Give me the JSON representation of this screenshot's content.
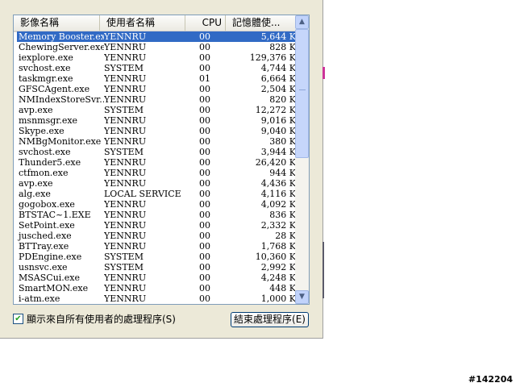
{
  "columns": [
    "影像名稱",
    "使用者名稱",
    "CPU",
    "記憶體使..."
  ],
  "processes": [
    {
      "name": "Memory Booster.exe",
      "user": "YENNRU",
      "cpu": "00",
      "mem": "5,644 K",
      "selected": true
    },
    {
      "name": "ChewingServer.exe",
      "user": "YENNRU",
      "cpu": "00",
      "mem": "828 K"
    },
    {
      "name": "iexplore.exe",
      "user": "YENNRU",
      "cpu": "00",
      "mem": "129,376 K"
    },
    {
      "name": "svchost.exe",
      "user": "SYSTEM",
      "cpu": "00",
      "mem": "4,744 K"
    },
    {
      "name": "taskmgr.exe",
      "user": "YENNRU",
      "cpu": "01",
      "mem": "6,664 K"
    },
    {
      "name": "GFSCAgent.exe",
      "user": "YENNRU",
      "cpu": "00",
      "mem": "2,504 K"
    },
    {
      "name": "NMIndexStoreSvr....",
      "user": "YENNRU",
      "cpu": "00",
      "mem": "820 K"
    },
    {
      "name": "avp.exe",
      "user": "SYSTEM",
      "cpu": "00",
      "mem": "12,272 K"
    },
    {
      "name": "msnmsgr.exe",
      "user": "YENNRU",
      "cpu": "00",
      "mem": "9,016 K"
    },
    {
      "name": "Skype.exe",
      "user": "YENNRU",
      "cpu": "00",
      "mem": "9,040 K"
    },
    {
      "name": "NMBgMonitor.exe",
      "user": "YENNRU",
      "cpu": "00",
      "mem": "380 K"
    },
    {
      "name": "svchost.exe",
      "user": "SYSTEM",
      "cpu": "00",
      "mem": "3,944 K"
    },
    {
      "name": "Thunder5.exe",
      "user": "YENNRU",
      "cpu": "00",
      "mem": "26,420 K"
    },
    {
      "name": "ctfmon.exe",
      "user": "YENNRU",
      "cpu": "00",
      "mem": "944 K"
    },
    {
      "name": "avp.exe",
      "user": "YENNRU",
      "cpu": "00",
      "mem": "4,436 K"
    },
    {
      "name": "alg.exe",
      "user": "LOCAL SERVICE",
      "cpu": "00",
      "mem": "4,116 K"
    },
    {
      "name": "gogobox.exe",
      "user": "YENNRU",
      "cpu": "00",
      "mem": "4,092 K"
    },
    {
      "name": "BTSTAC~1.EXE",
      "user": "YENNRU",
      "cpu": "00",
      "mem": "836 K"
    },
    {
      "name": "SetPoint.exe",
      "user": "YENNRU",
      "cpu": "00",
      "mem": "2,332 K"
    },
    {
      "name": "jusched.exe",
      "user": "YENNRU",
      "cpu": "00",
      "mem": "28 K"
    },
    {
      "name": "BTTray.exe",
      "user": "YENNRU",
      "cpu": "00",
      "mem": "1,768 K"
    },
    {
      "name": "PDEngine.exe",
      "user": "SYSTEM",
      "cpu": "00",
      "mem": "10,360 K"
    },
    {
      "name": "usnsvc.exe",
      "user": "SYSTEM",
      "cpu": "00",
      "mem": "2,992 K"
    },
    {
      "name": "MSASCui.exe",
      "user": "YENNRU",
      "cpu": "00",
      "mem": "4,248 K"
    },
    {
      "name": "SmartMON.exe",
      "user": "YENNRU",
      "cpu": "00",
      "mem": "448 K"
    },
    {
      "name": "i-atm.exe",
      "user": "YENNRU",
      "cpu": "00",
      "mem": "1,000 K"
    }
  ],
  "show_all_users_label": "顯示來自所有使用者的處理程序(S)",
  "show_all_users_checked": true,
  "end_process_label": "結束處理程序(E)",
  "watermark": "#142204",
  "icons": {
    "scroll_up": "up-arrow",
    "scroll_down": "down-arrow",
    "check": "checkmark"
  },
  "colors": {
    "selection": "#316ac5",
    "panel": "#ece9d8",
    "accent_edge": "#cc3399"
  }
}
